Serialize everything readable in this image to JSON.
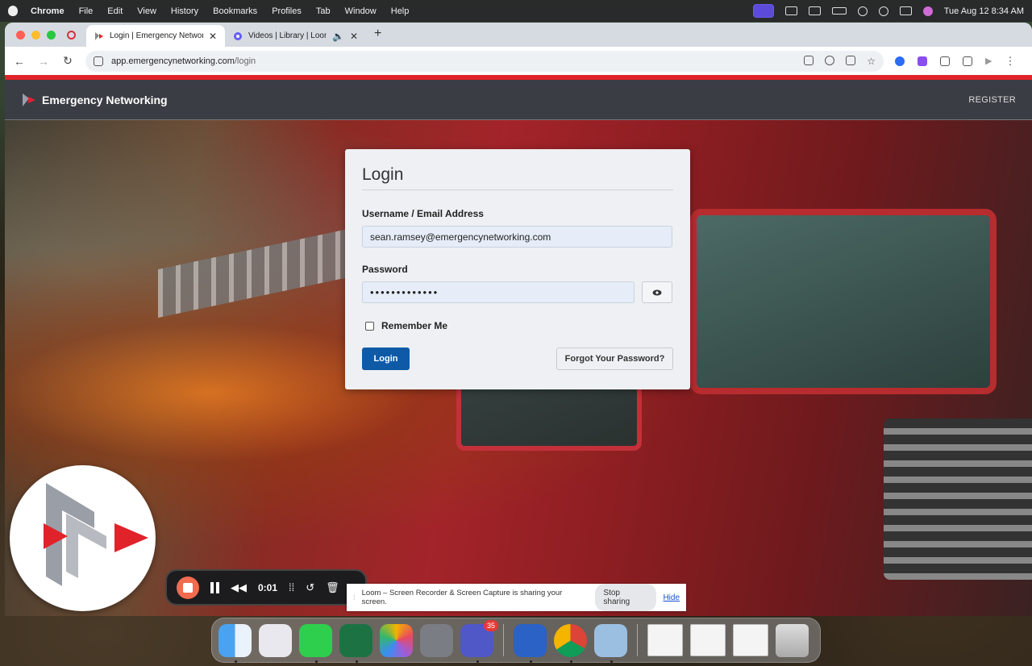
{
  "menubar": {
    "app": "Chrome",
    "items": [
      "File",
      "Edit",
      "View",
      "History",
      "Bookmarks",
      "Profiles",
      "Tab",
      "Window",
      "Help"
    ],
    "clock": "Tue Aug 12  8:34 AM"
  },
  "browser": {
    "tabs": [
      {
        "title": "Login | Emergency Networking"
      },
      {
        "title": "Videos | Library | Loom"
      }
    ],
    "url_host": "app.emergencynetworking.com",
    "url_path": "/login"
  },
  "site": {
    "brand": "Emergency Networking",
    "register": "REGISTER"
  },
  "login": {
    "title": "Login",
    "username_label": "Username / Email Address",
    "username_value": "sean.ramsey@emergencynetworking.com",
    "password_label": "Password",
    "password_value": "•••••••••••••",
    "remember": "Remember Me",
    "login_button": "Login",
    "forgot_button": "Forgot Your Password?"
  },
  "loom": {
    "timer": "0:01",
    "sharing_text": "Loom – Screen Recorder & Screen Capture is sharing your screen.",
    "stop_sharing": "Stop sharing",
    "hide": "Hide"
  },
  "dock": {
    "teams_badge": "35"
  }
}
